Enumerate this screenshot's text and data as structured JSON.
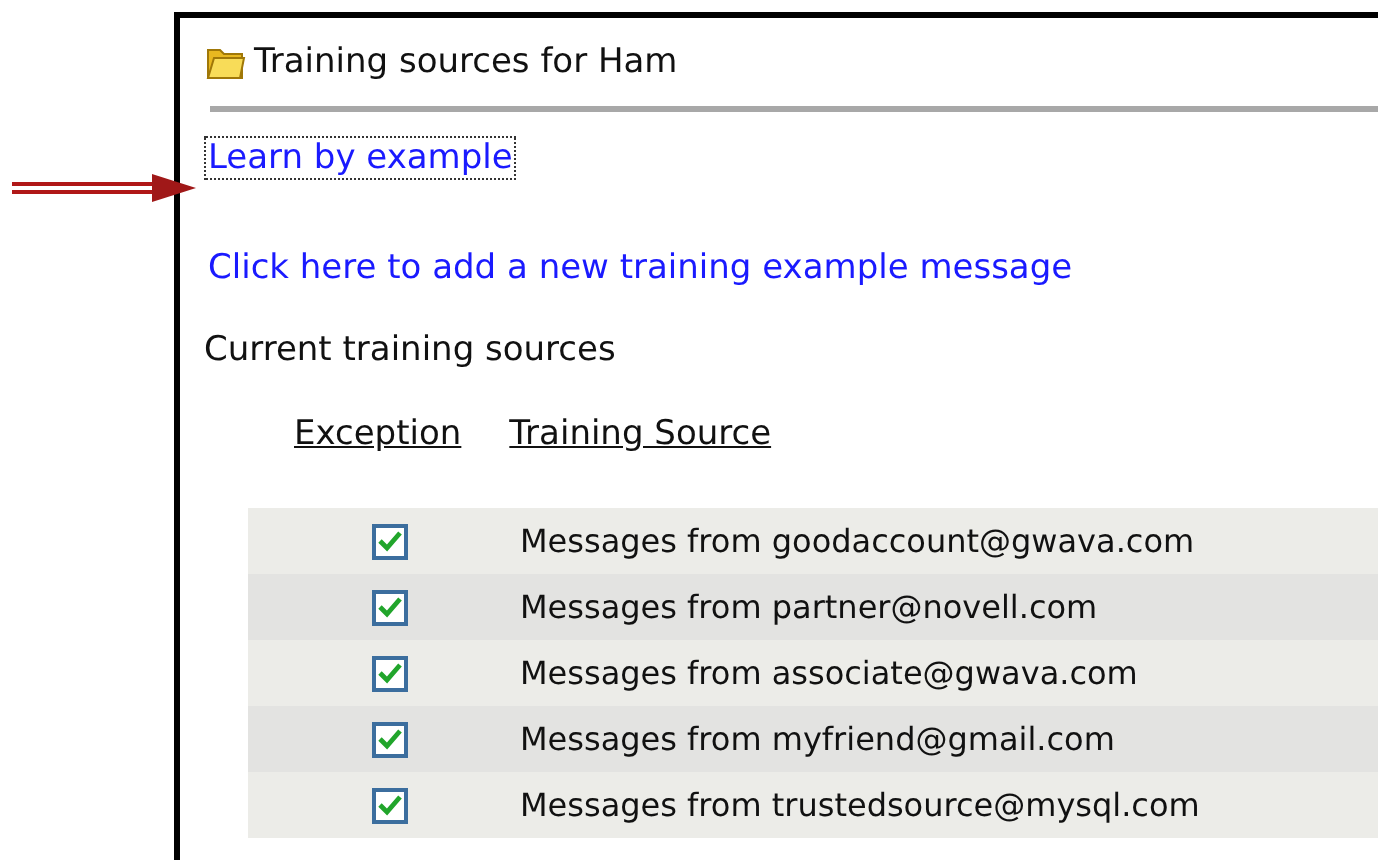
{
  "panel": {
    "title": "Training sources for Ham"
  },
  "links": [
    {
      "label": "Learn by example",
      "focused": true
    },
    {
      "label": "Click here to add a new training example message",
      "focused": false
    }
  ],
  "section_label": "Current training sources",
  "table": {
    "columns": [
      "Exception",
      "Training Source"
    ],
    "rows": [
      {
        "checked": true,
        "source": "Messages from goodaccount@gwava.com"
      },
      {
        "checked": true,
        "source": "Messages from partner@novell.com"
      },
      {
        "checked": true,
        "source": "Messages from associate@gwava.com"
      },
      {
        "checked": true,
        "source": "Messages from myfriend@gmail.com"
      },
      {
        "checked": true,
        "source": "Messages from trustedsource@mysql.com"
      }
    ]
  }
}
